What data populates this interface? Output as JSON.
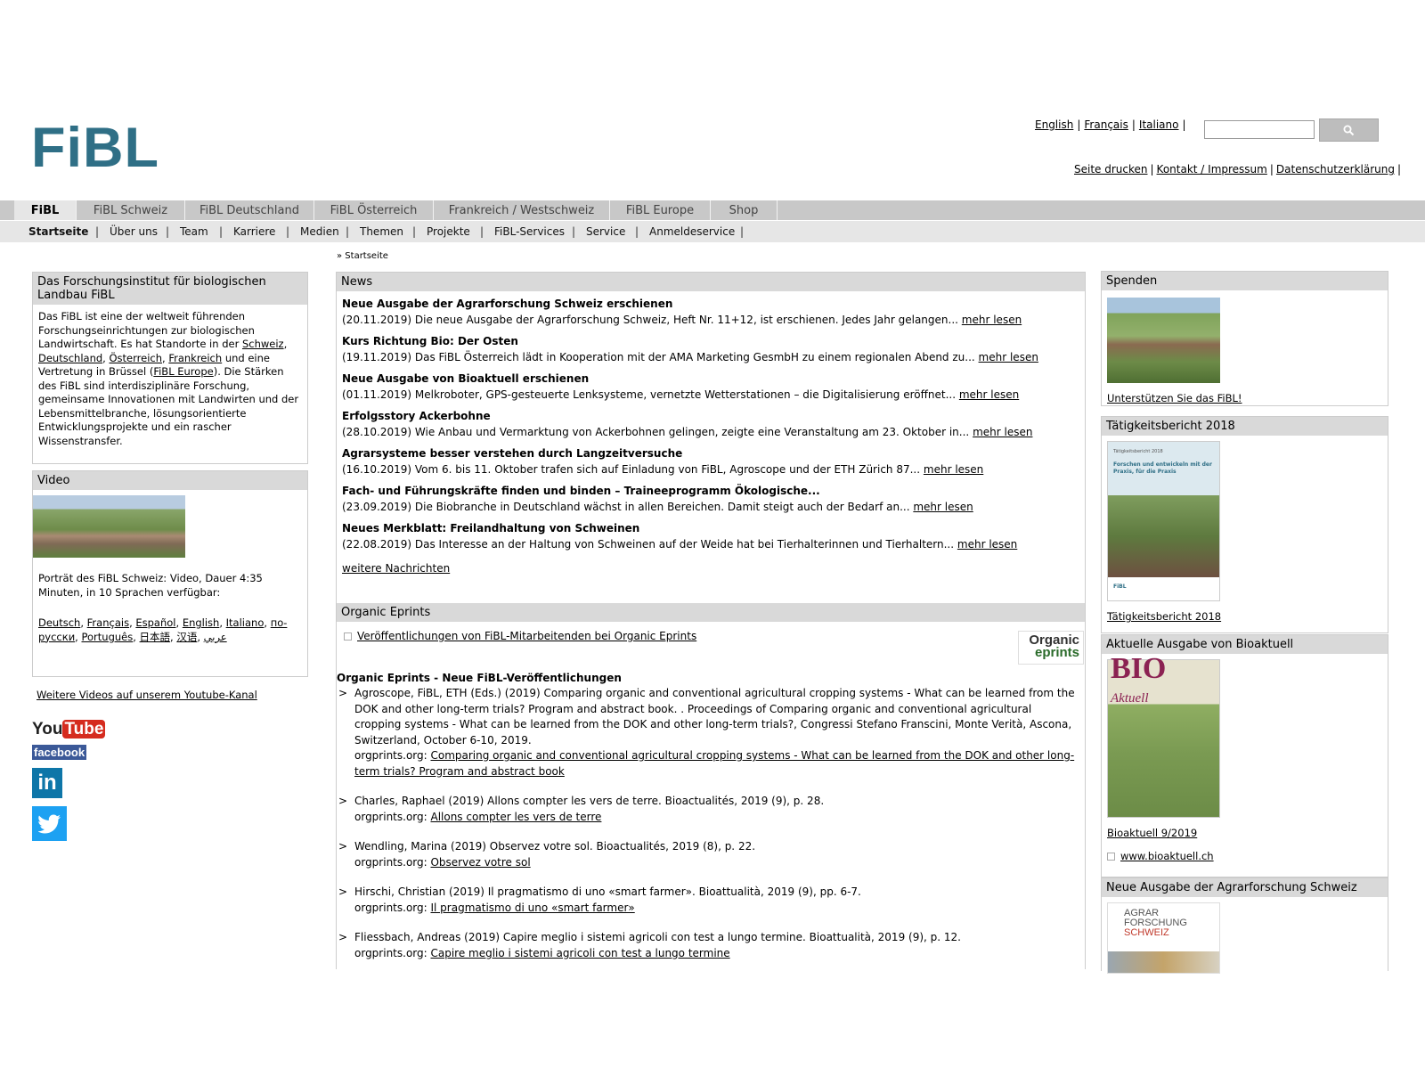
{
  "header": {
    "logo_text": "FiBL",
    "languages": [
      "English",
      "Français",
      "Italiano"
    ],
    "utility_links": [
      "Seite drucken",
      "Kontakt / Impressum",
      "Datenschutzerklärung"
    ]
  },
  "main_nav": [
    "FiBL",
    "FiBL Schweiz",
    "FiBL Deutschland",
    "FiBL Österreich",
    "Frankreich / Westschweiz",
    "FiBL Europe",
    "Shop"
  ],
  "sub_nav": [
    "Startseite",
    "Über uns",
    "Team",
    "Karriere",
    "Medien",
    "Themen",
    "Projekte",
    "FiBL-Services",
    "Service",
    "Anmeldeservice"
  ],
  "breadcrumb": "» Startseite",
  "left": {
    "about_title": "Das Forschungsinstitut für biologischen Landbau FiBL",
    "about_text_1": "Das FiBL ist eine der weltweit führenden Forschungseinrichtungen zur biologischen Landwirtschaft. Es hat Standorte in der ",
    "about_link_schweiz": "Schweiz",
    "about_sep_1": ", ",
    "about_link_deutschland": "Deutschland",
    "about_sep_2": ", ",
    "about_link_oesterreich": "Österreich",
    "about_sep_3": ", ",
    "about_link_frankreich": "Frankreich",
    "about_text_2": " und eine Vertretung in Brüssel (",
    "about_link_europe": "FiBL Europe",
    "about_text_3": "). Die Stärken des FiBL sind interdisziplinäre Forschung, gemeinsame Innovationen mit Landwirten und der Lebensmittelbranche, lösungsorientierte Entwicklungsprojekte und ein rascher Wissenstransfer.",
    "video_title": "Video",
    "video_text": "Porträt des FiBL Schweiz: Video, Dauer 4:35 Minuten, in 10 Sprachen verfügbar:",
    "video_languages": [
      "Deutsch",
      "Français",
      "Español",
      "English",
      "Italiano",
      "по-русски",
      "Português",
      "日本語",
      "汉语",
      "عربي"
    ],
    "youtube_link": "Weitere Videos auf unserem Youtube-Kanal",
    "social": {
      "youtube_a": "You",
      "youtube_b": "Tube",
      "facebook": "facebook",
      "linkedin": "in"
    }
  },
  "news": {
    "title": "News",
    "items": [
      {
        "title": "Neue Ausgabe der Agrarforschung Schweiz erschienen",
        "text": "(20.11.2019) Die neue Ausgabe der Agrarforschung Schweiz, Heft Nr. 11+12, ist erschienen. Jedes Jahr gelangen...",
        "more": "mehr lesen"
      },
      {
        "title": "Kurs Richtung Bio: Der Osten",
        "text": "(19.11.2019) Das FiBL Österreich lädt in Kooperation mit der AMA Marketing GesmbH zu einem regionalen Abend zu...",
        "more": "mehr lesen"
      },
      {
        "title": "Neue Ausgabe von Bioaktuell erschienen",
        "text": "(01.11.2019) Melkroboter, GPS-gesteuerte Lenksysteme, vernetzte Wetterstationen – die Digitalisierung eröffnet...",
        "more": "mehr lesen"
      },
      {
        "title": "Erfolgsstory Ackerbohne",
        "text": "(28.10.2019) Wie Anbau und Vermarktung von Ackerbohnen gelingen, zeigte eine Veranstaltung am 23. Oktober in...",
        "more": "mehr lesen"
      },
      {
        "title": "Agrarsysteme besser verstehen durch Langzeitversuche",
        "text": "(16.10.2019) Vom 6. bis 11. Oktober trafen sich auf Einladung von FiBL, Agroscope und der ETH Zürich 87...",
        "more": "mehr lesen"
      },
      {
        "title": "Fach- und Führungskräfte finden und binden – Traineeprogramm Ökologische...",
        "text": "(23.09.2019) Die Biobranche in Deutschland wächst in allen Bereichen. Damit steigt auch der Bedarf an...",
        "more": "mehr lesen"
      },
      {
        "title": "Neues Merkblatt: Freilandhaltung von Schweinen",
        "text": "(22.08.2019) Das Interesse an der Haltung von Schweinen auf der Weide hat bei Tierhalterinnen und Tierhaltern...",
        "more": "mehr lesen"
      }
    ],
    "more_news": "weitere Nachrichten"
  },
  "eprints": {
    "title": "Organic Eprints",
    "link": "Veröffentlichungen von FiBL-Mitarbeitenden bei Organic Eprints",
    "logo_line1": "Organic",
    "logo_line2": "eprints",
    "heading": "Organic Eprints - Neue FiBL-Veröffentlichungen",
    "bullet": ">",
    "prefix": "orgprints.org: ",
    "items": [
      {
        "citation": "Agroscope, FiBL, ETH (Eds.) (2019) Comparing organic and conventional agricultural cropping systems - What can be learned from the DOK and other long-term trials? Program and abstract book. . Proceedings of Comparing organic and conventional agricultural cropping systems - What can be learned from the DOK and other long-term trials?, Congressi Stefano Franscini, Monte Verità, Ascona, Switzerland, October 6-10, 2019.",
        "link": "Comparing organic and conventional agricultural cropping systems - What can be learned from the DOK and other long-term trials? Program and abstract book"
      },
      {
        "citation": "Charles, Raphael (2019) Allons compter les vers de terre. Bioactualités, 2019 (9), p. 28.",
        "link": "Allons compter les vers de terre"
      },
      {
        "citation": "Wendling, Marina (2019) Observez votre sol. Bioactualités, 2019 (8), p. 22.",
        "link": "Observez votre sol"
      },
      {
        "citation": "Hirschi, Christian (2019) Il pragmatismo di uno «smart farmer». Bioattualità, 2019 (9), pp. 6-7.",
        "link": "Il pragmatismo di uno «smart farmer»"
      },
      {
        "citation": "Fliessbach, Andreas (2019) Capire meglio i sistemi agricoli con test a lungo termine. Bioattualità, 2019 (9), p. 12.",
        "link": "Capire meglio i sistemi agricoli con test a lungo termine"
      }
    ]
  },
  "right": {
    "spenden_title": "Spenden",
    "spenden_link": "Unterstützen Sie das FiBL!",
    "taetig_title": "Tätigkeitsbericht 2018",
    "taetig_cover_label": "Tätigkeitsbericht 2018",
    "taetig_cover_text": "Forschen und entwickeln mit der Praxis, für die Praxis",
    "taetig_link": "Tätigkeitsbericht 2018",
    "bioakt_title": "Aktuelle Ausgabe von Bioaktuell",
    "bioakt_cover_big": "BIO",
    "bioakt_cover_small": "Aktuell",
    "bioakt_link": "Bioaktuell 9/2019",
    "bioakt_web": "www.bioaktuell.ch",
    "agrar_title": "Neue Ausgabe der Agrarforschung Schweiz",
    "agrar_cover_1": "AGRAR",
    "agrar_cover_2": "FORSCHUNG",
    "agrar_cover_3": "SCHWEIZ"
  }
}
